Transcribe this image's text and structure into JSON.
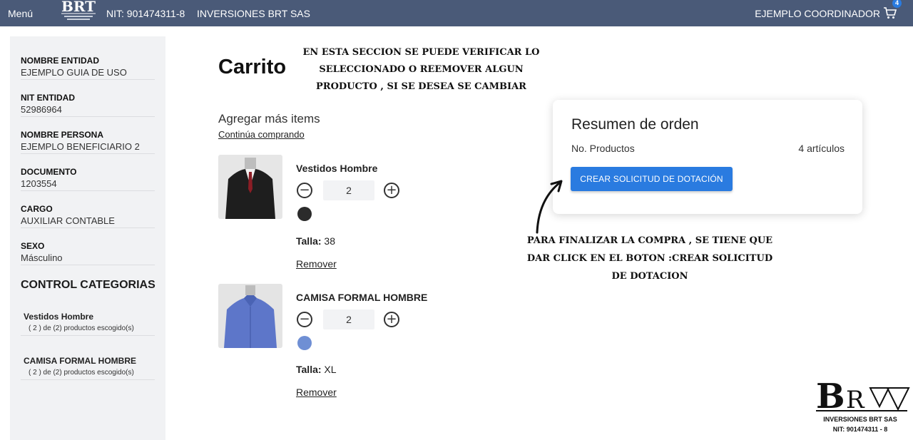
{
  "topbar": {
    "menu_label": "Menú",
    "logo_icon": "brt-logo-icon",
    "nit": "NIT: 901474311-8",
    "company": "INVERSIONES BRT SAS",
    "user": "EJEMPLO COORDINADOR",
    "cart_icon": "cart-icon",
    "cart_count": "4",
    "bar_color": "#4a5a78",
    "badge_color": "#2a7be0"
  },
  "sidebar": {
    "fields": [
      {
        "label": "NOMBRE ENTIDAD",
        "value": "EJEMPLO GUIA DE USO"
      },
      {
        "label": "NIT ENTIDAD",
        "value": "52986964"
      },
      {
        "label": "NOMBRE PERSONA",
        "value": "EJEMPLO BENEFICIARIO 2"
      },
      {
        "label": "DOCUMENTO",
        "value": "1203554"
      },
      {
        "label": "CARGO",
        "value": "AUXILIAR CONTABLE"
      },
      {
        "label": "SEXO",
        "value": "Másculino"
      }
    ],
    "section_title": "CONTROL CATEGORIAS",
    "categories": [
      {
        "name": "Vestidos Hombre",
        "count": "( 2 ) de (2) productos escogido(s)"
      },
      {
        "name": "CAMISA FORMAL HOMBRE",
        "count": "( 2 ) de (2) productos escogido(s)"
      }
    ]
  },
  "main": {
    "title": "Carrito",
    "note_top": "EN ESTA SECCION SE PUEDE VERIFICAR LO SELECCIONADO O REEMOVER ALGUN PRODUCTO , SI SE DESEA SE CAMBIAR",
    "agregar": "Agregar más items",
    "continua": "Continúa comprando",
    "products": [
      {
        "name": "Vestidos Hombre",
        "qty": "2",
        "color": "#2b2b2b",
        "talla_label": "Talla:",
        "talla_value": " 38",
        "remove": "Remover"
      },
      {
        "name": "CAMISA FORMAL HOMBRE",
        "qty": "2",
        "color": "#6f8fd4",
        "talla_label": "Talla:",
        "talla_value": " XL",
        "remove": "Remover"
      }
    ],
    "note_bottom": "PARA FINALIZAR LA COMPRA , SE TIENE QUE DAR CLICK EN EL BOTON :CREAR SOLICITUD DE DOTACION"
  },
  "summary": {
    "title": "Resumen de orden",
    "label": "No. Productos",
    "value": "4 artículos",
    "button": "CREAR SOLICITUD DE DOTACIÓN",
    "button_color": "#2a7be0"
  },
  "brand": {
    "line1": "INVERSIONES BRT SAS",
    "line2": "NIT: 901474311 - 8"
  }
}
